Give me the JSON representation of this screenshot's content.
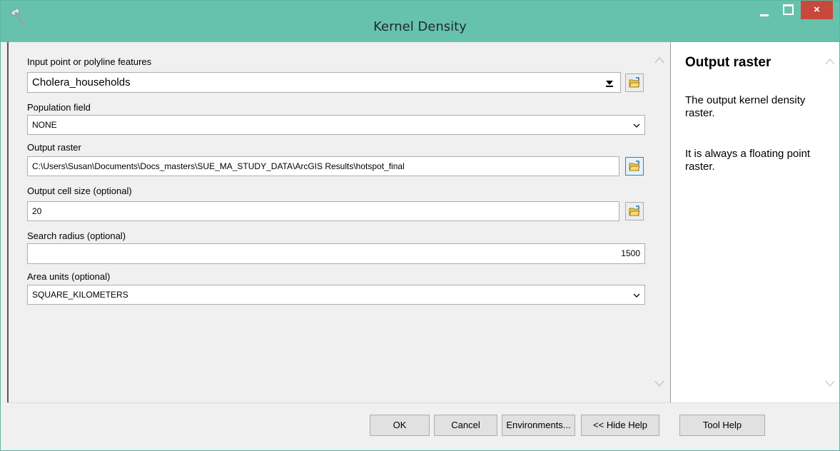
{
  "window": {
    "title": "Kernel Density",
    "close_label": "×",
    "accent_color": "#66c2ad",
    "close_color": "#c9483c"
  },
  "params": {
    "input_features": {
      "label": "Input point or polyline features",
      "value": "Cholera_households"
    },
    "population_field": {
      "label": "Population field",
      "value": "NONE"
    },
    "output_raster": {
      "label": "Output raster",
      "value": "C:\\Users\\Susan\\Documents\\Docs_masters\\SUE_MA_STUDY_DATA\\ArcGIS Results\\hotspot_final"
    },
    "cell_size": {
      "label": "Output cell size (optional)",
      "value": "20"
    },
    "search_radius": {
      "label": "Search radius (optional)",
      "value": "1500"
    },
    "area_units": {
      "label": "Area units (optional)",
      "value": "SQUARE_KILOMETERS"
    }
  },
  "help": {
    "title": "Output raster",
    "paragraph1": "The output kernel density raster.",
    "paragraph2": "It is always a floating point raster."
  },
  "buttons": {
    "ok": "OK",
    "cancel": "Cancel",
    "environments": "Environments...",
    "hide_help": "<< Hide Help",
    "tool_help": "Tool Help"
  },
  "icons": [
    "hammer-icon",
    "minimize-icon",
    "maximize-icon",
    "close-icon",
    "folder-open-icon",
    "chevron-down-icon",
    "scroll-up-icon",
    "scroll-down-icon"
  ]
}
